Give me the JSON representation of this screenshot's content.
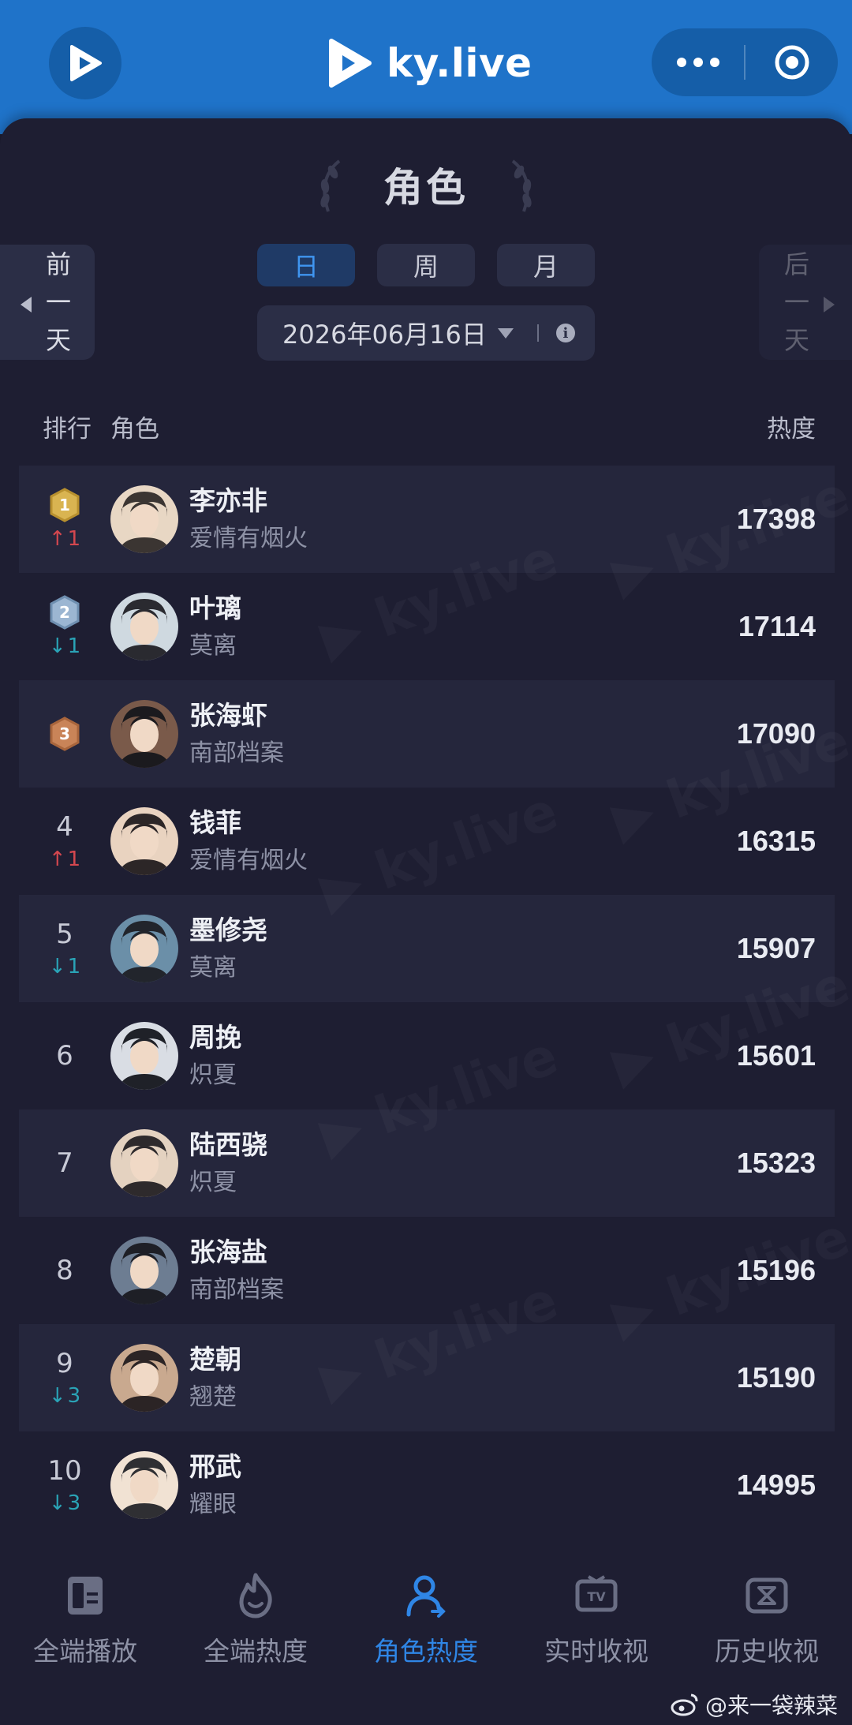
{
  "header": {
    "brand": "ky.live",
    "icons": {
      "app": "play-logo-icon",
      "more": "more-dots-icon",
      "target": "target-icon"
    },
    "accent": "#1f73c9"
  },
  "section": {
    "title": "角色"
  },
  "nav_buttons": {
    "prev": "前一天",
    "next": "后一天"
  },
  "period_tabs": [
    {
      "label": "日",
      "active": true
    },
    {
      "label": "周",
      "active": false
    },
    {
      "label": "月",
      "active": false
    }
  ],
  "date": {
    "value": "2026年06月16日"
  },
  "list_header": {
    "rank": "排行",
    "role": "角色",
    "heat": "热度"
  },
  "rows": [
    {
      "rank": "1",
      "medal": "gold",
      "change": "1",
      "direction": "up",
      "role": "李亦非",
      "drama": "爱情有烟火",
      "heat": "17398"
    },
    {
      "rank": "2",
      "medal": "silver",
      "change": "1",
      "direction": "down",
      "role": "叶璃",
      "drama": "莫离",
      "heat": "17114"
    },
    {
      "rank": "3",
      "medal": "bronze",
      "change": "",
      "direction": "",
      "role": "张海虾",
      "drama": "南部档案",
      "heat": "17090"
    },
    {
      "rank": "4",
      "medal": "",
      "change": "1",
      "direction": "up",
      "role": "钱菲",
      "drama": "爱情有烟火",
      "heat": "16315"
    },
    {
      "rank": "5",
      "medal": "",
      "change": "1",
      "direction": "down",
      "role": "墨修尧",
      "drama": "莫离",
      "heat": "15907"
    },
    {
      "rank": "6",
      "medal": "",
      "change": "",
      "direction": "",
      "role": "周挽",
      "drama": "炽夏",
      "heat": "15601"
    },
    {
      "rank": "7",
      "medal": "",
      "change": "",
      "direction": "",
      "role": "陆西骁",
      "drama": "炽夏",
      "heat": "15323"
    },
    {
      "rank": "8",
      "medal": "",
      "change": "",
      "direction": "",
      "role": "张海盐",
      "drama": "南部档案",
      "heat": "15196"
    },
    {
      "rank": "9",
      "medal": "",
      "change": "3",
      "direction": "down",
      "role": "楚朝",
      "drama": "翘楚",
      "heat": "15190"
    },
    {
      "rank": "10",
      "medal": "",
      "change": "3",
      "direction": "down",
      "role": "邢武",
      "drama": "耀眼",
      "heat": "14995"
    }
  ],
  "bottom_nav": [
    {
      "label": "全端播放",
      "icon": "play-card-icon",
      "active": false
    },
    {
      "label": "全端热度",
      "icon": "flame-icon",
      "active": false
    },
    {
      "label": "角色热度",
      "icon": "person-icon",
      "active": true
    },
    {
      "label": "实时收视",
      "icon": "tv-icon",
      "active": false
    },
    {
      "label": "历史收视",
      "icon": "history-icon",
      "active": false
    }
  ],
  "credit": {
    "text": "@来一袋辣菜",
    "icon": "weibo-icon"
  }
}
